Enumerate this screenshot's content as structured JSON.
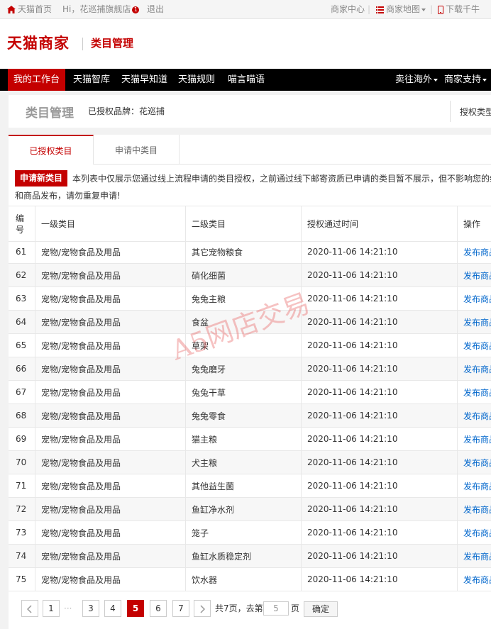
{
  "topbar": {
    "home": "天猫首页",
    "greeting": "Hi，花巡捕旗舰店",
    "badge": "1",
    "logout": "退出",
    "merchant_center": "商家中心",
    "merchant_map": "商家地图",
    "download": "下载千牛"
  },
  "header": {
    "logo": "天猫商家",
    "subtitle": "类目管理"
  },
  "nav": {
    "items": [
      "我的工作台",
      "天猫智库",
      "天猫早知道",
      "天猫规则",
      "喵言喵语"
    ],
    "right": [
      "卖往海外",
      "商家支持"
    ]
  },
  "page_header": {
    "title": "类目管理",
    "brand": "已授权品牌：花巡捕",
    "auth_type": "授权类型"
  },
  "tabs": [
    "已授权类目",
    "申请中类目"
  ],
  "notice": {
    "button": "申请新类目",
    "line1": "本列表中仅展示您通过线上流程申请的类目授权，之前通过线下邮寄资质已申请的类目暂不展示，但不影响您的经营",
    "line2": "和商品发布，请勿重复申请!"
  },
  "table": {
    "headers": [
      "编号",
      "一级类目",
      "二级类目",
      "授权通过时间",
      "操作"
    ],
    "rows": [
      [
        "61",
        "宠物/宠物食品及用品",
        "其它宠物粮食",
        "2020-11-06 14:21:10",
        "发布商品"
      ],
      [
        "62",
        "宠物/宠物食品及用品",
        "硝化细菌",
        "2020-11-06 14:21:10",
        "发布商品"
      ],
      [
        "63",
        "宠物/宠物食品及用品",
        "兔兔主粮",
        "2020-11-06 14:21:10",
        "发布商品"
      ],
      [
        "64",
        "宠物/宠物食品及用品",
        "食盆",
        "2020-11-06 14:21:10",
        "发布商品"
      ],
      [
        "65",
        "宠物/宠物食品及用品",
        "草架",
        "2020-11-06 14:21:10",
        "发布商品"
      ],
      [
        "66",
        "宠物/宠物食品及用品",
        "兔兔磨牙",
        "2020-11-06 14:21:10",
        "发布商品"
      ],
      [
        "67",
        "宠物/宠物食品及用品",
        "兔兔干草",
        "2020-11-06 14:21:10",
        "发布商品"
      ],
      [
        "68",
        "宠物/宠物食品及用品",
        "兔兔零食",
        "2020-11-06 14:21:10",
        "发布商品"
      ],
      [
        "69",
        "宠物/宠物食品及用品",
        "猫主粮",
        "2020-11-06 14:21:10",
        "发布商品"
      ],
      [
        "70",
        "宠物/宠物食品及用品",
        "犬主粮",
        "2020-11-06 14:21:10",
        "发布商品"
      ],
      [
        "71",
        "宠物/宠物食品及用品",
        "其他益生菌",
        "2020-11-06 14:21:10",
        "发布商品"
      ],
      [
        "72",
        "宠物/宠物食品及用品",
        "鱼缸净水剂",
        "2020-11-06 14:21:10",
        "发布商品"
      ],
      [
        "73",
        "宠物/宠物食品及用品",
        "笼子",
        "2020-11-06 14:21:10",
        "发布商品"
      ],
      [
        "74",
        "宠物/宠物食品及用品",
        "鱼缸水质稳定剂",
        "2020-11-06 14:21:10",
        "发布商品"
      ],
      [
        "75",
        "宠物/宠物食品及用品",
        "饮水器",
        "2020-11-06 14:21:10",
        "发布商品"
      ]
    ]
  },
  "watermark": "A5网店交易",
  "pagination": {
    "pages": [
      "1",
      "3",
      "4",
      "5",
      "6",
      "7"
    ],
    "current": "5",
    "ellipsis": "···",
    "total": "共7页，去第",
    "input_value": "5",
    "page_unit": "页",
    "confirm": "确定"
  },
  "colors": {
    "brand": "#c40000",
    "nav_bg": "#000000",
    "link": "#0066cc"
  }
}
